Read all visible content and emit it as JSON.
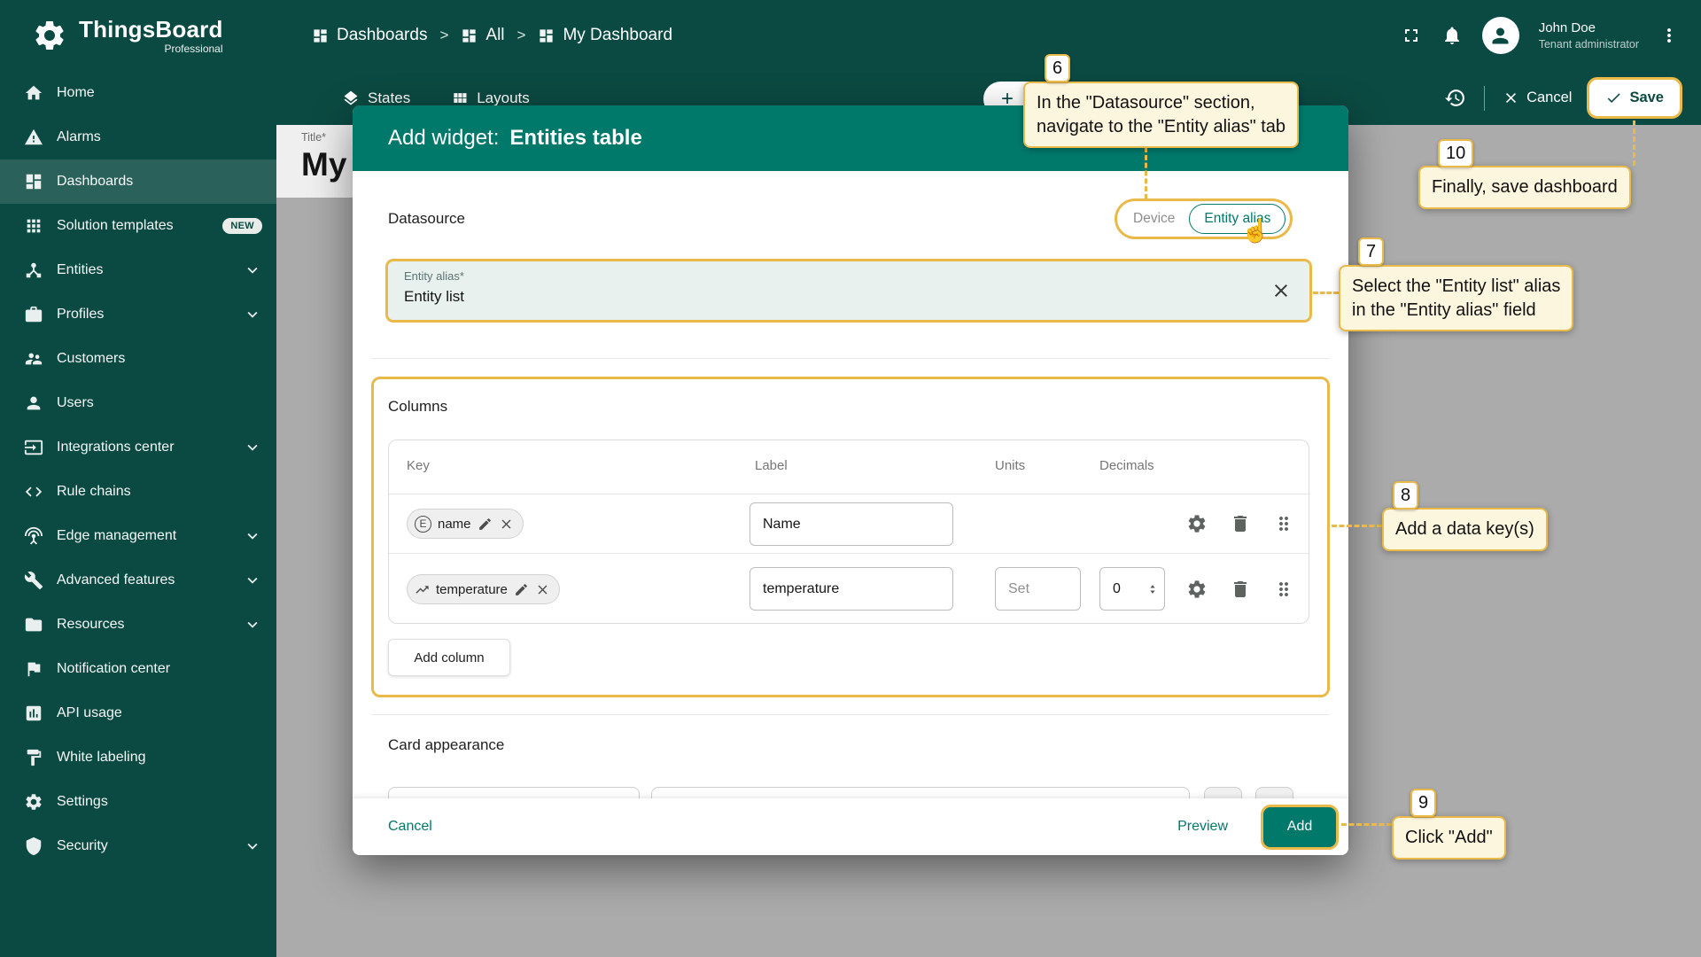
{
  "colors": {
    "accent": "#00796B",
    "sidebar": "#0B4A42",
    "highlight": "#E9B94A",
    "callout_bg": "#FDF6DE"
  },
  "brand": {
    "name": "ThingsBoard",
    "edition": "Professional"
  },
  "sidebar": {
    "new_badge": "NEW",
    "items": [
      {
        "label": "Home",
        "icon": "home-icon"
      },
      {
        "label": "Alarms",
        "icon": "warning-icon"
      },
      {
        "label": "Dashboards",
        "icon": "dashboards-icon",
        "active": true
      },
      {
        "label": "Solution templates",
        "icon": "apps-icon",
        "badge": "NEW"
      },
      {
        "label": "Entities",
        "icon": "hub-icon",
        "chevron": true
      },
      {
        "label": "Profiles",
        "icon": "briefcase-icon",
        "chevron": true
      },
      {
        "label": "Customers",
        "icon": "people-icon"
      },
      {
        "label": "Users",
        "icon": "person-icon"
      },
      {
        "label": "Integrations center",
        "icon": "input-icon",
        "chevron": true
      },
      {
        "label": "Rule chains",
        "icon": "code-icon"
      },
      {
        "label": "Edge management",
        "icon": "antenna-icon",
        "chevron": true
      },
      {
        "label": "Advanced features",
        "icon": "wrench-icon",
        "chevron": true
      },
      {
        "label": "Resources",
        "icon": "folder-icon",
        "chevron": true
      },
      {
        "label": "Notification center",
        "icon": "flag-icon"
      },
      {
        "label": "API usage",
        "icon": "chart-icon"
      },
      {
        "label": "White labeling",
        "icon": "paint-icon"
      },
      {
        "label": "Settings",
        "icon": "gear-icon"
      },
      {
        "label": "Security",
        "icon": "shield-icon",
        "chevron": true
      }
    ]
  },
  "header": {
    "breadcrumbs": [
      "Dashboards",
      "All",
      "My Dashboard"
    ],
    "separator": ">",
    "user": {
      "name": "John Doe",
      "role": "Tenant administrator"
    }
  },
  "toolbar": {
    "states_label": "States",
    "layouts_label": "Layouts",
    "cancel_label": "Cancel",
    "save_label": "Save",
    "plus_label": "+"
  },
  "canvas": {
    "title_label": "Title*",
    "title_value": "My"
  },
  "modal": {
    "title_prefix": "Add widget:",
    "title_name": "Entities table",
    "datasource": {
      "label": "Datasource",
      "toggle_device": "Device",
      "toggle_entity_alias": "Entity alias",
      "field_label": "Entity alias*",
      "field_value": "Entity list"
    },
    "columns": {
      "label": "Columns",
      "headers": [
        "Key",
        "Label",
        "Units",
        "Decimals"
      ],
      "rows": [
        {
          "key": "name",
          "icon_letter": "E",
          "label": "Name"
        },
        {
          "key": "temperature",
          "label": "temperature",
          "units_placeholder": "Set",
          "decimals": "0"
        }
      ],
      "add_column": "Add column"
    },
    "card_appearance_label": "Card appearance",
    "footer": {
      "cancel": "Cancel",
      "preview": "Preview",
      "add": "Add"
    }
  },
  "annotations": {
    "a6": {
      "num": "6",
      "line1": "In the \"Datasource\" section,",
      "line2": "navigate to the \"Entity alias\" tab"
    },
    "a7": {
      "num": "7",
      "line1": "Select the \"Entity list\" alias",
      "line2": "in the \"Entity alias\" field"
    },
    "a8": {
      "num": "8",
      "line1": "Add a data key(s)"
    },
    "a9": {
      "num": "9",
      "line1": "Click \"Add\""
    },
    "a10": {
      "num": "10",
      "line1": "Finally, save dashboard"
    }
  }
}
